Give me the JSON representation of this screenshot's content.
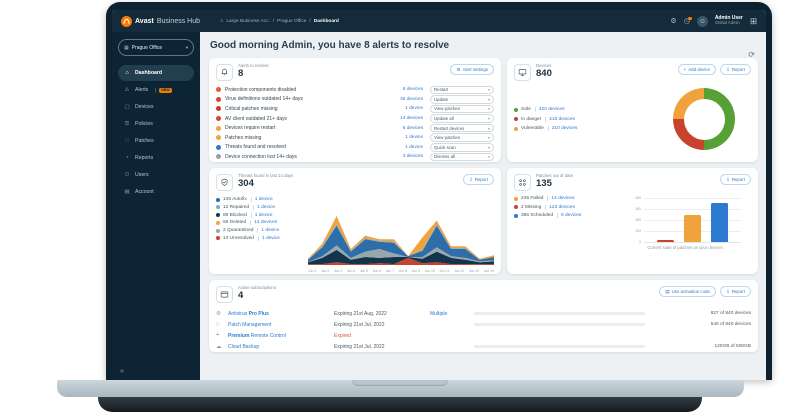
{
  "brand": {
    "bold": "Avast",
    "rest": " Business Hub"
  },
  "breadcrumb": {
    "home_icon": "⌂",
    "sep": "/",
    "items": [
      "Large Business Acc.",
      "Prague Office",
      "Dashboard"
    ]
  },
  "topbar": {
    "gear_icon": "⚙",
    "history_icon": "◷",
    "avatar_icon": "☺",
    "apps_icon": "⊞",
    "user_name": "Admin User",
    "user_role": "Global Admin"
  },
  "sidebar": {
    "selector": {
      "icon": "▦",
      "label": "Prague Office",
      "chevron": "▾"
    },
    "items": [
      {
        "icon": "⌂",
        "label": "Dashboard"
      },
      {
        "icon": "⚠",
        "label": "Alerts",
        "badge": "NEW"
      },
      {
        "icon": "▢",
        "label": "Devices"
      },
      {
        "icon": "☰",
        "label": "Policies"
      },
      {
        "icon": "∷",
        "label": "Patches"
      },
      {
        "icon": "◔",
        "label": "Reports"
      },
      {
        "icon": "⚇",
        "label": "Users"
      },
      {
        "icon": "▤",
        "label": "Account"
      }
    ],
    "collapse": "«"
  },
  "header": {
    "greeting": "Good morning Admin, you have 8 alerts to resolve",
    "refresh_icon": "⟳"
  },
  "alerts_card": {
    "title": "Alerts to resolve",
    "count": "8",
    "settings_button": "Alert settings",
    "settings_icon": "⚙",
    "chevron": "▾",
    "rows": [
      {
        "label": "Protection components disabled",
        "devices": "6 devices",
        "action": "Restart",
        "color": "#e2592e"
      },
      {
        "label": "Virus definitions outdated 14+ days",
        "devices": "45 devices",
        "action": "Update",
        "color": "#d8442f"
      },
      {
        "label": "Critical patches missing",
        "devices": "1 device",
        "action": "View patches",
        "color": "#c53a2a"
      },
      {
        "label": "AV client outdated 21+ days",
        "devices": "14 devices",
        "action": "Update all",
        "color": "#d8442f"
      },
      {
        "label": "Devices require restart",
        "devices": "6 devices",
        "action": "Restart devices",
        "color": "#f0a23c"
      },
      {
        "label": "Patches missing",
        "devices": "1 device",
        "action": "View patches",
        "color": "#f0a23c"
      },
      {
        "label": "Threats found and resolved",
        "devices": "1 device",
        "action": "Quick scan",
        "color": "#2b79d0"
      },
      {
        "label": "Device connection lost 14+ days",
        "devices": "3 devices",
        "action": "Dismiss all",
        "color": "#93a1ab"
      }
    ]
  },
  "devices_card": {
    "title": "Devices",
    "count": "840",
    "add_icon": "+",
    "add_button": "Add device",
    "report_icon": "⇩",
    "report_button": "Report",
    "legend": [
      {
        "label": "Safe",
        "value": "420 devices",
        "color": "#56a035"
      },
      {
        "label": "In danger",
        "value": "210 devices",
        "color": "#c8432e"
      },
      {
        "label": "Vulnerable",
        "value": "210 devices",
        "color": "#f0a23c"
      }
    ]
  },
  "threats_card": {
    "title": "Threats found in last 14 days",
    "count": "304",
    "report_icon": "⇩",
    "report_button": "Report",
    "legend": [
      {
        "text": "145 Autofix",
        "devices": "1 device",
        "color": "#2d6da8"
      },
      {
        "text": "12 Repaired",
        "devices": "1 device",
        "color": "#7fa8cc"
      },
      {
        "text": "89 Blocked",
        "devices": "1 device",
        "color": "#14344c"
      },
      {
        "text": "56 Deleted",
        "devices": "14 devices",
        "color": "#f0a23c"
      },
      {
        "text": "2 Quarantined",
        "devices": "1 device",
        "color": "#9aa6ae"
      },
      {
        "text": "13 Unresolved",
        "devices": "1 device",
        "color": "#c8432e"
      }
    ]
  },
  "patches_card": {
    "title": "Patches out of date",
    "count": "135",
    "report_icon": "⇩",
    "report_button": "Report",
    "caption": "Current state of patches on your devices",
    "legend": [
      {
        "text": "245 Failed",
        "devices": "14 devices",
        "color": "#f0a23c"
      },
      {
        "text": "2 Missing",
        "devices": "123 devices",
        "color": "#c8432e"
      },
      {
        "text": "356 Scheduled",
        "devices": "6 devices",
        "color": "#2b79d0"
      }
    ]
  },
  "subscriptions_card": {
    "title": "Active subscriptions",
    "count": "4",
    "activation_icon": "▤",
    "activation_button": "Use activation code",
    "report_icon": "⇩",
    "report_button": "Report",
    "rows": [
      {
        "icon": "⚙",
        "name_pre": "Antivirus ",
        "name_bold": "Pro Plus",
        "name_post": "",
        "expiry": "Expiring 21st Aug, 2022",
        "tag": "Multiple",
        "progress": 92,
        "value": "827 of 840 devices"
      },
      {
        "icon": "∷",
        "name_pre": "",
        "name_bold": "",
        "name_post": "Patch Management",
        "expiry": "Expiring 21st Jul, 2022",
        "tag": "",
        "progress": 62,
        "value": "540 of 840 devices"
      },
      {
        "icon": "⌖",
        "name_pre": "",
        "name_bold": "Premium",
        "name_post": " Remote Control",
        "expiry": "Expired",
        "tag": "",
        "progress": null,
        "value": ""
      },
      {
        "icon": "☁",
        "name_pre": "",
        "name_bold": "",
        "name_post": "Cloud Backup",
        "expiry": "Expiring 21st Jul, 2022",
        "tag": "",
        "progress": 62,
        "value": "120GB of 500GB"
      }
    ]
  },
  "chart_data": [
    {
      "type": "pie",
      "donut": true,
      "title": "Devices",
      "labels": [
        "Safe",
        "In danger",
        "Vulnerable"
      ],
      "values": [
        420,
        210,
        210
      ],
      "colors": [
        "#56a035",
        "#c8432e",
        "#f0a23c"
      ],
      "note": "clockwise from top: Safe 50%, In danger 25%, Vulnerable 25%"
    },
    {
      "type": "area",
      "stacked": true,
      "title": "Threats found in last 14 days",
      "x": [
        "Jun 1",
        "Jun 2",
        "Jun 3",
        "Jun 4",
        "Jun 5",
        "Jun 6",
        "Jun 7",
        "Jun 8",
        "Jun 9",
        "Jun 10",
        "Jun 11",
        "Jun 12",
        "Jun 13",
        "Jun 14"
      ],
      "series": [
        {
          "name": "Unresolved",
          "color": "#c8432e",
          "values": [
            1,
            1,
            3,
            1,
            1,
            2,
            1,
            8,
            2,
            3,
            1,
            1,
            1,
            1
          ]
        },
        {
          "name": "Blocked",
          "color": "#14344c",
          "values": [
            2,
            7,
            14,
            5,
            8,
            6,
            8,
            1,
            5,
            12,
            7,
            5,
            2,
            3
          ]
        },
        {
          "name": "Quarantined",
          "color": "#9aa6ae",
          "values": [
            0,
            2,
            5,
            2,
            6,
            10,
            4,
            0,
            2,
            5,
            2,
            2,
            1,
            1
          ]
        },
        {
          "name": "Autofix",
          "color": "#2d6da8",
          "values": [
            3,
            10,
            22,
            7,
            14,
            8,
            12,
            1,
            7,
            24,
            8,
            10,
            2,
            4
          ]
        },
        {
          "name": "Repaired",
          "color": "#7fa8cc",
          "values": [
            0,
            1,
            2,
            1,
            1,
            1,
            1,
            0,
            1,
            2,
            1,
            1,
            0,
            0
          ]
        },
        {
          "name": "Deleted",
          "color": "#f0a23c",
          "values": [
            1,
            3,
            9,
            2,
            3,
            2,
            3,
            0,
            14,
            4,
            2,
            2,
            1,
            2
          ]
        }
      ],
      "legend_position": "left",
      "grid": false
    },
    {
      "type": "bar",
      "title": "Current state of patches on your devices",
      "categories": [
        "Missing",
        "Failed",
        "Scheduled"
      ],
      "values": [
        2,
        245,
        356
      ],
      "colors": [
        "#c8432e",
        "#f0a23c",
        "#2b79d0"
      ],
      "ylim": [
        0,
        400
      ],
      "yticks": [
        400,
        300,
        200,
        100,
        0
      ],
      "grid": true
    }
  ]
}
